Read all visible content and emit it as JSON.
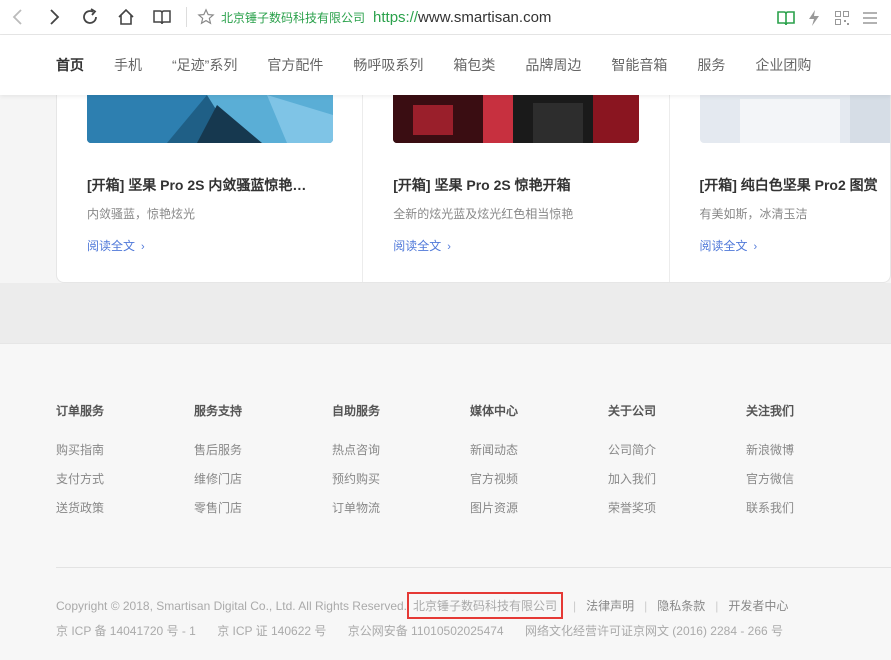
{
  "browser": {
    "site_name": "北京锤子数码科技有限公司",
    "url_scheme": "https://",
    "url_host": "www.smartisan.com"
  },
  "nav": {
    "items": [
      "首页",
      "手机",
      "“足迹”系列",
      "官方配件",
      "畅呼吸系列",
      "箱包类",
      "品牌周边",
      "智能音箱",
      "服务",
      "企业团购"
    ]
  },
  "cards": [
    {
      "title": "[开箱] 坚果 Pro 2S 内敛骚蓝惊艳…",
      "desc": "内敛骚蓝，惊艳炫光",
      "link": "阅读全文"
    },
    {
      "title": "[开箱] 坚果 Pro 2S 惊艳开箱",
      "desc": "全新的炫光蓝及炫光红色相当惊艳",
      "link": "阅读全文"
    },
    {
      "title": "[开箱] 纯白色坚果 Pro2 图赏",
      "desc": "有美如斯，冰清玉洁",
      "link": "阅读全文"
    }
  ],
  "footer": {
    "columns": [
      {
        "title": "订单服务",
        "links": [
          "购买指南",
          "支付方式",
          "送货政策"
        ]
      },
      {
        "title": "服务支持",
        "links": [
          "售后服务",
          "维修门店",
          "零售门店"
        ]
      },
      {
        "title": "自助服务",
        "links": [
          "热点咨询",
          "预约购买",
          "订单物流"
        ]
      },
      {
        "title": "媒体中心",
        "links": [
          "新闻动态",
          "官方视频",
          "图片资源"
        ]
      },
      {
        "title": "关于公司",
        "links": [
          "公司简介",
          "加入我们",
          "荣誉奖项"
        ]
      },
      {
        "title": "关注我们",
        "links": [
          "新浪微博",
          "官方微信",
          "联系我们"
        ]
      }
    ],
    "copyright": "Copyright © 2018, Smartisan Digital Co., Ltd. All Rights Reserved.",
    "company": "北京锤子数码科技有限公司",
    "legal_links": [
      "法律声明",
      "隐私条款",
      "开发者中心"
    ],
    "icp": [
      "京 ICP 备 14041720 号 - 1",
      "京 ICP 证 140622 号",
      "京公网安备 11010502025474",
      "网络文化经营许可证京网文 (2016) 2284 - 266 号"
    ]
  },
  "colors": {
    "accent_green": "#2aa14b",
    "link_blue": "#5079d9",
    "highlight_red": "#e53935"
  }
}
